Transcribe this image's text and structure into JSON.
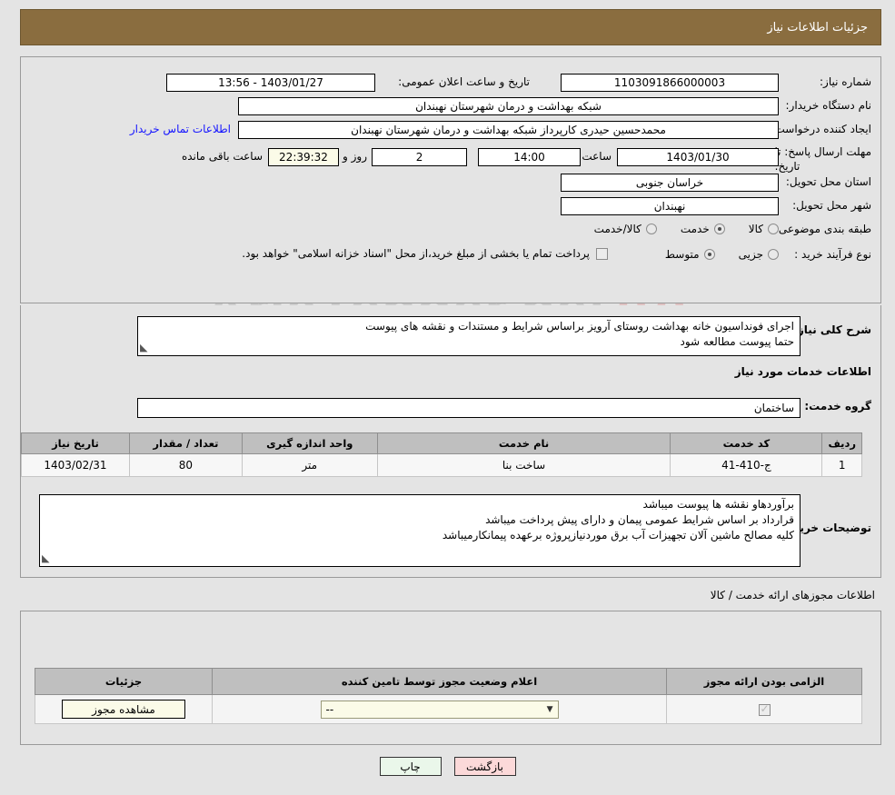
{
  "header": {
    "title": "جزئیات اطلاعات نیاز",
    "bar_color": "#8a6d3f"
  },
  "watermark": {
    "text": "AriaTender.net"
  },
  "main": {
    "need_number_label": "شماره نیاز:",
    "need_number_value": "1103091866000003",
    "public_announce_label": "تاریخ و ساعت اعلان عمومی:",
    "public_announce_value": "1403/01/27 - 13:56",
    "buyer_org_label": "نام دستگاه خریدار:",
    "buyer_org_value": "شبکه بهداشت و درمان شهرستان نهبندان",
    "requester_label": "ایجاد کننده درخواست:",
    "requester_value": "محمدحسین حیدری کارپرداز شبکه بهداشت و درمان شهرستان نهبندان",
    "contact_link": "اطلاعات تماس خریدار",
    "deadline_label_line1": "مهلت ارسال پاسخ: تا",
    "deadline_label_line2": "تاریخ:",
    "deadline_date": "1403/01/30",
    "hour_label": "ساعت",
    "deadline_hour": "14:00",
    "days_value": "2",
    "days_label": "روز و",
    "countdown_value": "22:39:32",
    "remaining_label": "ساعت باقی مانده",
    "province_label": "استان محل تحویل:",
    "province_value": "خراسان جنوبی",
    "city_label": "شهر محل تحویل:",
    "city_value": "نهبندان",
    "category_label": "طبقه بندی موضوعی:",
    "category_options": [
      {
        "label": "کالا",
        "selected": false
      },
      {
        "label": "خدمت",
        "selected": true
      },
      {
        "label": "کالا/خدمت",
        "selected": false
      }
    ],
    "process_label": "نوع فرآیند خرید :",
    "process_options": [
      {
        "label": "جزیی",
        "selected": false
      },
      {
        "label": "متوسط",
        "selected": true
      }
    ],
    "treasury_checkbox_checked": false,
    "treasury_text": "پرداخت تمام یا بخشی از مبلغ خرید،از محل \"اسناد خزانه اسلامی\" خواهد بود."
  },
  "description": {
    "need_summary_label": "شرح کلی نیاز:",
    "need_summary_value": "اجرای فونداسیون خانه بهداشت روستای آرویز براساس شرایط و مستندات و نقشه های پیوست\nحتما پیوست مطالعه شود",
    "services_info_title": "اطلاعات خدمات مورد نیاز",
    "service_group_label": "گروه خدمت:",
    "service_group_value": "ساختمان",
    "buyer_notes_label": "توضیحات خریدار:",
    "buyer_notes_value": "برآوردهاو نقشه ها پیوست میباشد\nقرارداد بر اساس شرایط عمومی پیمان و دارای پیش پرداخت میباشد\nکلیه مصالح ماشین آلان تجهیزات آب برق موردنیازپروژه برعهده پیمانکارمیباشد"
  },
  "items_table": {
    "columns": [
      "ردیف",
      "کد خدمت",
      "نام خدمت",
      "واحد اندازه گیری",
      "تعداد / مقدار",
      "تاریخ نیاز"
    ],
    "rows": [
      {
        "row_no": "1",
        "service_code": "ج-410-41",
        "service_name": "ساخت بنا",
        "unit": "متر",
        "quantity": "80",
        "need_date": "1403/02/31"
      }
    ]
  },
  "permits": {
    "section_title": "اطلاعات مجوزهای ارائه خدمت / کالا",
    "columns": [
      "الزامی بودن ارائه مجوز",
      "اعلام وضعیت مجوز توسط تامین کننده",
      "جزئیات"
    ],
    "rows": [
      {
        "required_checked": true,
        "status_value": "--",
        "details_button": "مشاهده مجوز"
      }
    ]
  },
  "footer": {
    "print_label": "چاپ",
    "back_label": "بازگشت",
    "print_color": "#eaf7ea",
    "back_color": "#fcd9d9"
  }
}
